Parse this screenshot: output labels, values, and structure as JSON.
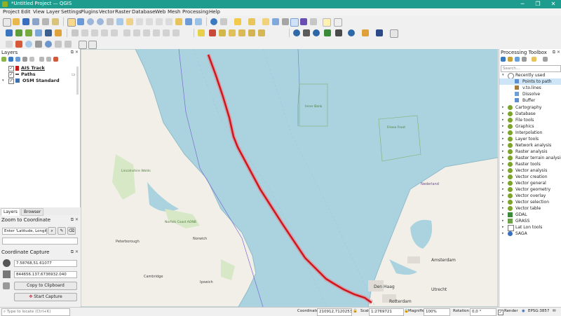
{
  "window": {
    "title": "*Untitled Project — QGIS",
    "minimize": "─",
    "maximize": "❐",
    "close": "✕"
  },
  "menu": [
    "Project",
    "Edit",
    "View",
    "Layer",
    "Settings",
    "Plugins",
    "Vector",
    "Raster",
    "Database",
    "Web",
    "Mesh",
    "Processing",
    "Help"
  ],
  "layers_panel": {
    "title": "Layers",
    "items": [
      {
        "name": "AIS Track",
        "checked": true
      },
      {
        "name": "Paths",
        "checked": true
      },
      {
        "name": "OSM Standard",
        "checked": true
      }
    ],
    "tabs": [
      "Layers",
      "Browser"
    ]
  },
  "zoom_panel": {
    "title": "Zoom to Coordinate",
    "placeholder": "Enter 'Latitude, Longitude'"
  },
  "capture_panel": {
    "title": "Coordinate Capture",
    "wgs_value": "7.58768,51.61077",
    "proj_value": "844656.137,6736932.040",
    "copy_label": "Copy to Clipboard",
    "start_label": "Start Capture"
  },
  "map": {
    "labels": [
      "Amsterdam",
      "Den Haag",
      "Rotterdam",
      "Utrecht",
      "Nederland",
      "Peterborough",
      "Cambridge",
      "Ipswich",
      "Norwich",
      "Lincolnshire Wolds",
      "Norfolk Coast AONB",
      "Inner Bank",
      "Friese Front"
    ]
  },
  "toolbox": {
    "title": "Processing Toolbox",
    "search_placeholder": "Search...",
    "recent_group": "Recently used",
    "recent": [
      "Points to path",
      "v.to.lines",
      "Dissolve",
      "Buffer"
    ],
    "groups": [
      "Cartography",
      "Database",
      "File tools",
      "Graphics",
      "Interpolation",
      "Layer tools",
      "Network analysis",
      "Raster analysis",
      "Raster terrain analysis",
      "Raster tools",
      "Vector analysis",
      "Vector creation",
      "Vector general",
      "Vector geometry",
      "Vector overlay",
      "Vector selection",
      "Vector table",
      "GDAL",
      "GRASS",
      "Lat Lon tools",
      "SAGA"
    ]
  },
  "statusbar": {
    "locate_placeholder": "Type to locate (Ctrl+K)",
    "coordinate_label": "Coordinate",
    "coordinate_value": "210912,7120253",
    "scale_label": "Scale",
    "scale_value": "1:2769721",
    "magnifier_label": "Magnifier",
    "magnifier_value": "100%",
    "rotation_label": "Rotation",
    "rotation_value": "0,0 °",
    "render_label": "Render",
    "crs_label": "EPSG:3857"
  },
  "colors": {
    "titlebar": "#1e9d8f",
    "sea": "#aad3df",
    "land": "#f2efe9",
    "track": "#d0161d"
  }
}
